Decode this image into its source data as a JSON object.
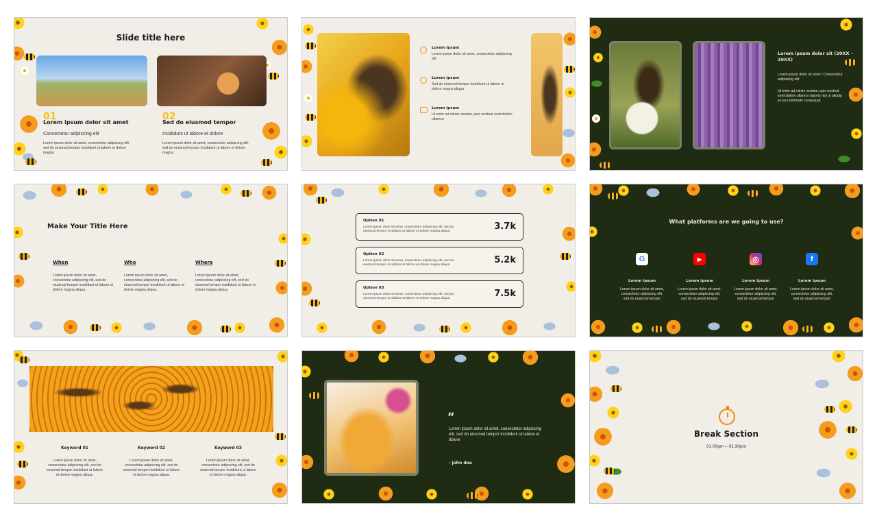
{
  "slides": {
    "s1": {
      "title": "Slide title here",
      "col1": {
        "num": "01",
        "heading": "Lorem ipsum dolor sit amet",
        "sub": "Consectetur adipiscing elit",
        "body": "Lorem ipsum dolor sit amet, consectetur adipiscing elit, sed do eiusmod tempor incididunt ut labore et dolore magna"
      },
      "col2": {
        "num": "02",
        "heading": "Sed do eiusmod tempor",
        "sub": "Incididunt ut labore et dolore",
        "body": "Lorem ipsum dolor sit amet, consectetur adipiscing elit, sed do eiusmod tempor incididunt ut labore et dolore magna"
      }
    },
    "s2": {
      "items": [
        {
          "heading": "Lorem ipsum",
          "body": "Lorem ipsum dolor sit amet, consectetur adipiscing elit"
        },
        {
          "heading": "Lorem ipsum",
          "body": "Sed do eiusmod tempor incididunt ut labore et dolore magna aliqua"
        },
        {
          "heading": "Lorem ipsum",
          "body": "Ut enim ad minim veniam, quis nostrud exercitation ullamco"
        }
      ]
    },
    "s3": {
      "heading": "Lorem ipsum dolor sit (20XX – 20XX)",
      "p1": "Lorem ipsum dolor sit amet / Consectetur adipiscing elit",
      "p2": "Ut enim ad minim veniam, quis nostrud exercitation ullamco laboris nisi ut aliquip ex ea commodo consequat."
    },
    "s4": {
      "title": "Make Your Title Here",
      "cols": [
        {
          "heading": "When",
          "body": "Lorem ipsum dolor sit amet, consectetur adipiscing elit, sed do eiusmod tempor incididunt ut labore et dolore magna aliqua."
        },
        {
          "heading": "Who",
          "body": "Lorem ipsum dolor sit amet, consectetur adipiscing elit, sed do eiusmod tempor incididunt ut labore et dolore magna aliqua."
        },
        {
          "heading": "Where",
          "body": "Lorem ipsum dolor sit amet, consectetur adipiscing elit, sed do eiusmod tempor incididunt ut labore et dolore magna aliqua."
        }
      ]
    },
    "s5": {
      "options": [
        {
          "label": "Option 01",
          "desc": "Lorem ipsum dolor sit amet, consectetur adipiscing elit, sed do eiusmod tempor incididunt ut labore et dolore magna aliqua.",
          "value": "3.7k"
        },
        {
          "label": "Option 02",
          "desc": "Lorem ipsum dolor sit amet, consectetur adipiscing elit, sed do eiusmod tempor incididunt ut labore et dolore magna aliqua.",
          "value": "5.2k"
        },
        {
          "label": "Option 03",
          "desc": "Lorem ipsum dolor sit amet, consectetur adipiscing elit, sed do eiusmod tempor incididunt ut labore et dolore magna aliqua.",
          "value": "7.5k"
        }
      ]
    },
    "s6": {
      "title": "What platforms are we going to use?",
      "platforms": [
        {
          "icon": "google-icon",
          "glyph": "G",
          "color": "#4285f4",
          "heading": "Lorem ipsum",
          "body": "Lorem ipsum dolor sit amet, consectetur adipiscing elit, sed do eiusmod tempor"
        },
        {
          "icon": "youtube-icon",
          "glyph": "▶",
          "color": "#ff0000",
          "heading": "Lorem ipsum",
          "body": "Lorem ipsum dolor sit amet, consectetur adipiscing elit, sed do eiusmod tempor"
        },
        {
          "icon": "instagram-icon",
          "glyph": "◎",
          "color": "#d6249f",
          "heading": "Lorem ipsum",
          "body": "Lorem ipsum dolor sit amet, consectetur adipiscing elit, sed do eiusmod tempor"
        },
        {
          "icon": "facebook-icon",
          "glyph": "f",
          "color": "#1877f2",
          "heading": "Lorem ipsum",
          "body": "Lorem ipsum dolor sit amet, consectetur adipiscing elit, sed do eiusmod tempor"
        }
      ]
    },
    "s7": {
      "keywords": [
        {
          "heading": "Keyword 01",
          "body": "Lorem ipsum dolor sit amet, consectetur adipiscing elit, sed do eiusmod tempor incididunt ut labore et dolore magna aliqua."
        },
        {
          "heading": "Keyword 02",
          "body": "Lorem ipsum dolor sit amet, consectetur adipiscing elit, sed do eiusmod tempor incididunt ut labore et dolore magna aliqua."
        },
        {
          "heading": "Keyword 03",
          "body": "Lorem ipsum dolor sit amet, consectetur adipiscing elit, sed do eiusmod tempor incididunt ut labore et dolore magna aliqua."
        }
      ]
    },
    "s8": {
      "quote_mark": "“",
      "quote": "Lorem ipsum dolor sit amet, consectetur adipiscing elit, sed do eiusmod tempor incididunt ut labore et dolore",
      "author": "- john doe"
    },
    "s9": {
      "title": "Break Section",
      "time": "01:00pm – 01:30pm"
    }
  },
  "colors": {
    "cream": "#f1ede7",
    "dark_green": "#1f2c13",
    "accent_orange": "#f08a0f",
    "accent_yellow": "#f3c11d"
  }
}
